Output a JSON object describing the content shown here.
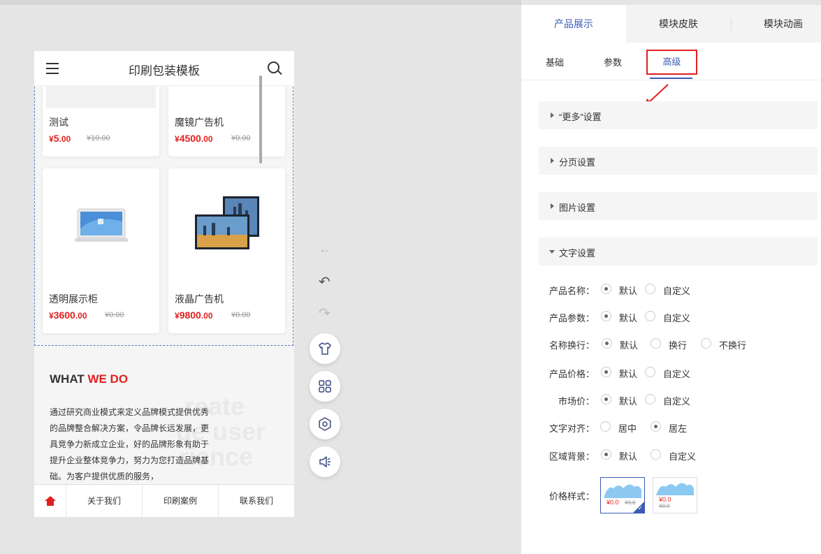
{
  "phone": {
    "title": "印刷包装模板",
    "products": [
      {
        "name": "测试",
        "price_symbol": "¥",
        "price": "5",
        "price_dec": ".00",
        "old": "¥10.00"
      },
      {
        "name": "魔镜广告机",
        "price_symbol": "¥",
        "price": "4500",
        "price_dec": ".00",
        "old": "¥0.00"
      },
      {
        "name": "透明展示柜",
        "price_symbol": "¥",
        "price": "3600",
        "price_dec": ".00",
        "old": "¥0.00"
      },
      {
        "name": "液晶广告机",
        "price_symbol": "¥",
        "price": "9800",
        "price_dec": ".00",
        "old": "¥0.00"
      }
    ],
    "what_we_do_a": "WHAT ",
    "what_we_do_b": "WE DO",
    "paragraph": "通过研究商业模式来定义品牌模式提供优秀的品牌整合解决方案，令品牌长远发展，更具竞争力新成立企业，好的品牌形象有助于提升企业整体竞争力，努力为您打造品牌基础。为客户提供优质的服务，",
    "ghost_lines": [
      "reate",
      "ue user",
      "rience"
    ],
    "nav": [
      "关于我们",
      "印刷案例",
      "联系我们"
    ]
  },
  "tools": {
    "back_arrow": "←",
    "undo": "↶",
    "redo": "↷"
  },
  "panel": {
    "tabs": [
      "产品展示",
      "模块皮肤",
      "模块动画"
    ],
    "subtabs": [
      "基础",
      "参数",
      "高级"
    ],
    "sections": [
      "“更多”设置",
      "分页设置",
      "图片设置",
      "文字设置"
    ],
    "settings": [
      {
        "label": "产品名称：",
        "options": [
          "默认",
          "自定义"
        ],
        "selected": 0
      },
      {
        "label": "产品参数：",
        "options": [
          "默认",
          "自定义"
        ],
        "selected": 0
      },
      {
        "label": "名称换行：",
        "options": [
          "默认",
          "换行",
          "不换行"
        ],
        "selected": 0
      },
      {
        "label": "产品价格：",
        "options": [
          "默认",
          "自定义"
        ],
        "selected": 0
      },
      {
        "label": "市场价：",
        "options": [
          "默认",
          "自定义"
        ],
        "selected": 0
      },
      {
        "label": "文字对齐：",
        "options": [
          "居中",
          "居左"
        ],
        "selected": 1
      },
      {
        "label": "区域背景：",
        "options": [
          "默认",
          "自定义"
        ],
        "selected": 0
      }
    ],
    "price_style_label": "价格样式：",
    "price_styles": [
      {
        "price": "¥0.0",
        "old": "¥0.0",
        "selected": true
      },
      {
        "price": "¥0.0",
        "old": "¥0.0",
        "selected": false
      }
    ]
  },
  "colors": {
    "accent": "#3b5bb5",
    "red": "#e02020"
  }
}
